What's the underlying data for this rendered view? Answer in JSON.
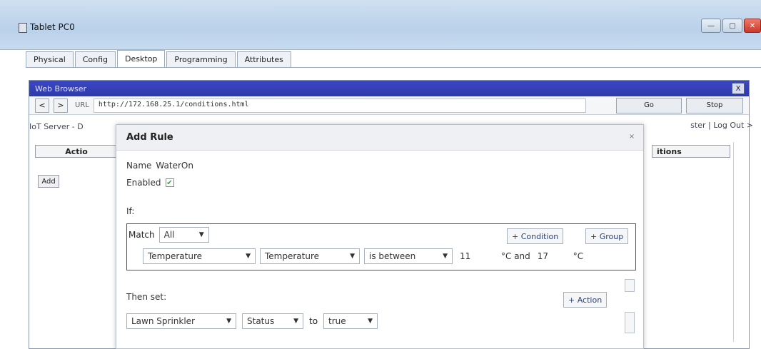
{
  "window": {
    "title": "Tablet PC0",
    "buttons": [
      "—",
      "▢",
      "✕"
    ]
  },
  "tabs": [
    "Physical",
    "Config",
    "Desktop",
    "Programming",
    "Attributes"
  ],
  "browser": {
    "title": "Web Browser",
    "close": "X",
    "back": "<",
    "forward": ">",
    "url_label": "URL",
    "url": "http://172.168.25.1/conditions.html",
    "go": "Go",
    "stop": "Stop"
  },
  "page": {
    "breadcrumb": "IoT Server - D",
    "userlinks": "ster | Log Out >",
    "actions_header": "Actio",
    "conditions_header": "itions",
    "add_button": "Add"
  },
  "modal": {
    "title": "Add Rule",
    "close": "×",
    "name_label": "Name",
    "name_value": "WaterOn",
    "enabled_label": "Enabled",
    "enabled_checked": "✔",
    "if_label": "If:",
    "match_label": "Match",
    "match_value": "All",
    "condition_button": "+ Condition",
    "group_button": "+ Group",
    "condition": {
      "device": "Temperature",
      "property": "Temperature",
      "operator": "is between",
      "low": "11",
      "unit1": "°C and",
      "high": "17",
      "unit2": "°C"
    },
    "then_label": "Then set:",
    "action_button": "+ Action",
    "action": {
      "device": "Lawn Sprinkler",
      "property": "Status",
      "to": "to",
      "value": "true"
    }
  }
}
